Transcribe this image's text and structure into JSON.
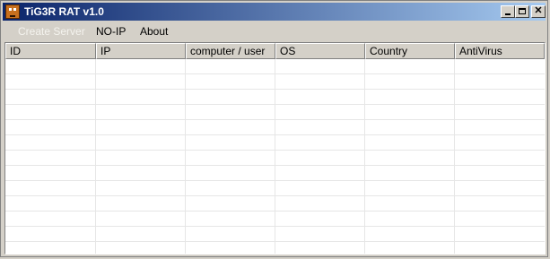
{
  "window": {
    "title": "TiG3R RAT v1.0",
    "controls": {
      "minimize_icon": "minimize-icon",
      "maximize_icon": "maximize-icon",
      "close_icon": "close-icon",
      "close_glyph": "✕"
    }
  },
  "menu": {
    "items": [
      {
        "label": "Create Server",
        "enabled": false
      },
      {
        "label": "NO-IP",
        "enabled": true
      },
      {
        "label": "About",
        "enabled": true
      }
    ]
  },
  "table": {
    "columns": [
      "ID",
      "IP",
      "computer / user",
      "OS",
      "Country",
      "AntiVirus"
    ],
    "rows": []
  },
  "colors": {
    "title_gradient_start": "#0a246a",
    "title_gradient_end": "#a6caf0",
    "face": "#d4d0c8"
  }
}
